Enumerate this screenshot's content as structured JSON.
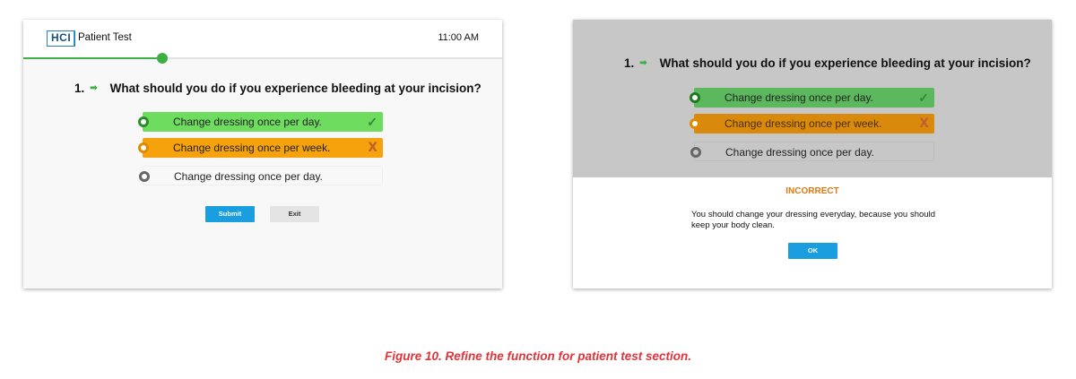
{
  "left_screen": {
    "header": {
      "logo": "HCI",
      "title": "Patient Test",
      "time": "11:00 AM"
    },
    "progress": {
      "fraction": 0.29
    },
    "question": {
      "number": "1.",
      "arrow_icon": "right-arrow-icon",
      "text": "What should you do if you experience bleeding at your incision?"
    },
    "options": [
      {
        "label": "Change dressing once per day.",
        "state": "correct",
        "mark": "✓"
      },
      {
        "label": "Change dressing once per week.",
        "state": "incorrect",
        "mark": "X"
      },
      {
        "label": "Change dressing once per day.",
        "state": "neutral",
        "mark": ""
      }
    ],
    "buttons": {
      "submit": "Submit",
      "exit": "Exit"
    }
  },
  "right_screen": {
    "question": {
      "number": "1.",
      "arrow_icon": "right-arrow-icon",
      "text": "What should you do if you experience bleeding at your incision?"
    },
    "options": [
      {
        "label": "Change dressing once per day.",
        "state": "correct",
        "mark": "✓"
      },
      {
        "label": "Change dressing once per week.",
        "state": "incorrect",
        "mark": "X"
      },
      {
        "label": "Change dressing once per day.",
        "state": "neutral",
        "mark": ""
      }
    ],
    "dialog": {
      "title": "INCORRECT",
      "message": "You should change your dressing everyday, because you should keep your body clean.",
      "ok": "OK"
    }
  },
  "caption": "Figure 10. Refine the function for patient test section.",
  "colors": {
    "correct": "#6edc5f",
    "incorrect": "#f5a20c",
    "primary_button": "#1a9ee0",
    "progress": "#3cb043",
    "incorrect_title": "#e07a10",
    "caption": "#e0333a"
  }
}
